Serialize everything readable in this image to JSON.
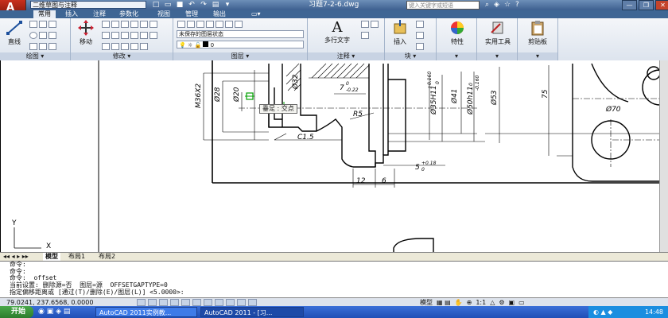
{
  "titlebar": {
    "app_logo": "A",
    "workspace": "二维草图与注释",
    "document_title": "习题7-2-6.dwg",
    "search_placeholder": "键入关键字或短语",
    "window_controls": [
      "—",
      "❐",
      "✕"
    ]
  },
  "ribbon_tabs": [
    "常用",
    "插入",
    "注释",
    "参数化",
    "视图",
    "管理",
    "输出"
  ],
  "ribbon": {
    "draw": {
      "title": "绘图",
      "line_label": "直线"
    },
    "modify": {
      "title": "修改",
      "move_label": "移动"
    },
    "layers": {
      "title": "图层",
      "layer_state": "未保存的图层状态",
      "current_layer": "0"
    },
    "annotation": {
      "title": "注释",
      "mtext_label": "多行文字"
    },
    "block": {
      "title": "块",
      "insert_label": "插入"
    },
    "properties": {
      "label": "特性"
    },
    "utilities": {
      "label": "实用工具"
    },
    "clipboard": {
      "label": "剪贴板"
    }
  },
  "drawing": {
    "dims": {
      "m36": "M36X2",
      "d28": "Ø28",
      "d20": "Ø20",
      "d32": "Ø32",
      "seven": "7",
      "seven_tol": "-0.22",
      "seven_tol_top": "0",
      "r5": "R5",
      "c15": "C1.5",
      "d35": "Ø35H11",
      "d35_tol": "+0.160",
      "d35_tol2": "0",
      "d41": "Ø41",
      "d50": "Ø50h11",
      "d50_tol": "0",
      "d50_tol2": "-0.160",
      "d53": "Ø53",
      "d75": "75",
      "d70": "Ø70",
      "five": "5",
      "five_tol": "+0.18",
      "five_tol2": "0",
      "d12": "12",
      "d6": "6"
    },
    "snap_tooltip": "垂足 : 交点",
    "ucs_y": "Y",
    "ucs_x": "X"
  },
  "layout_tabs": [
    "模型",
    "布局1",
    "布局2"
  ],
  "command_lines": [
    "命令:",
    "命令:",
    "命令:  offset",
    "当前设置: 删除源=否  图层=源  OFFSETGAPTYPE=0",
    "指定偏移距离或 [通过(T)/删除(E)/图层(L)] <5.0000>:"
  ],
  "status": {
    "coordinates": "79.0241, 237.6568, 0.0000",
    "model_label": "模型",
    "scale_label": "1:1"
  },
  "taskbar": {
    "start": "开始",
    "tasks": [
      "AutoCAD 2011实例教...",
      "AutoCAD 2011 - [习..."
    ],
    "time": "14:48"
  },
  "colors": {
    "titlebar": "#4a6f9f",
    "ribbon_tab": "#3e6694",
    "snap_marker": "#00a000"
  }
}
